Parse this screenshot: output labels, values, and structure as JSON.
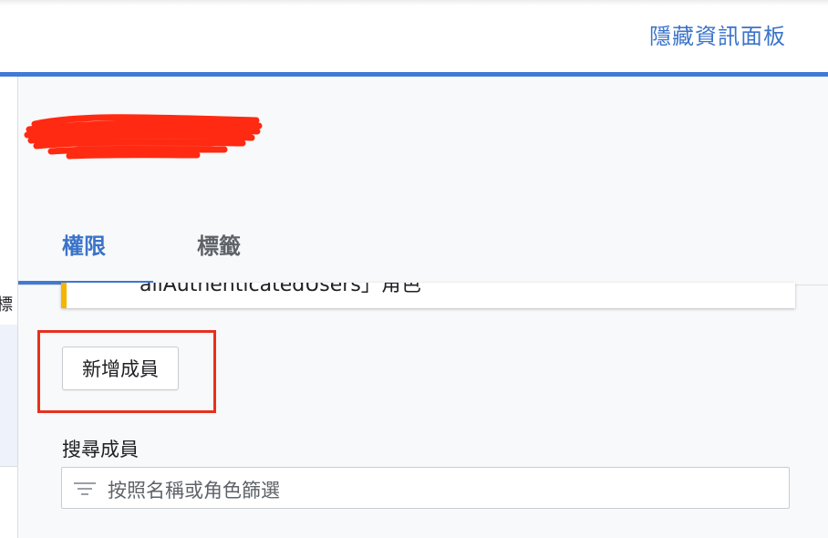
{
  "header": {
    "hide_panel_label": "隱藏資訊面板"
  },
  "left_strip": {
    "cut_label": "標"
  },
  "panel": {
    "title": "",
    "tabs": [
      {
        "label": "權限",
        "active": true
      },
      {
        "label": "標籤",
        "active": false
      }
    ]
  },
  "notice": {
    "text": "allAuthenticatedUsers」角色"
  },
  "members": {
    "add_member_label": "新增成員",
    "search_label": "搜尋成員",
    "filter_placeholder": "按照名稱或角色篩選",
    "filter_icon": "filter-list-icon"
  },
  "colors": {
    "accent": "#4179d6",
    "link": "#3b73c9",
    "highlight": "#e8301d",
    "warning": "#f4b400"
  }
}
